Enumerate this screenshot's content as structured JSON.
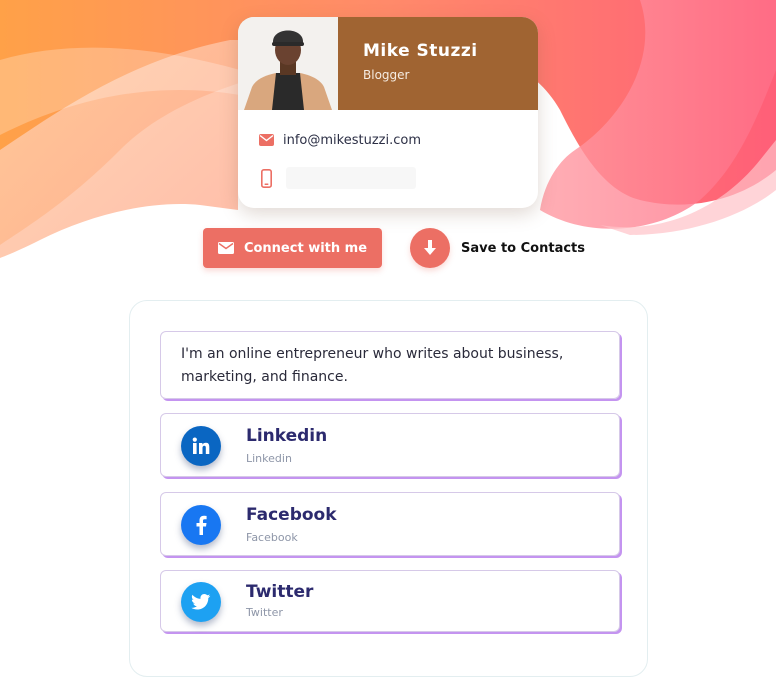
{
  "profile": {
    "name": "Mike Stuzzi",
    "role": "Blogger",
    "email": "info@mikestuzzi.com",
    "phone": "",
    "header_color": "#a06432"
  },
  "actions": {
    "connect_label": "Connect with me",
    "save_label": "Save to Contacts",
    "accent_color": "#ec6f64"
  },
  "bio": "I'm an online entrepreneur who writes about business, marketing, and finance.",
  "socials": [
    {
      "title": "Linkedin",
      "subtitle": "Linkedin",
      "icon": "linkedin-icon",
      "color": "#0a66c2"
    },
    {
      "title": "Facebook",
      "subtitle": "Facebook",
      "icon": "facebook-icon",
      "color": "#1877f2"
    },
    {
      "title": "Twitter",
      "subtitle": "Twitter",
      "icon": "twitter-icon",
      "color": "#1da1f2"
    }
  ]
}
